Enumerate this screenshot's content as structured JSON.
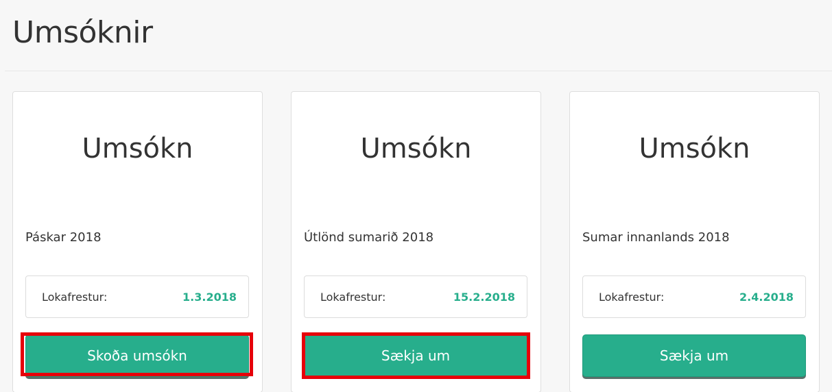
{
  "page": {
    "title": "Umsóknir"
  },
  "cards": [
    {
      "title": "Umsókn",
      "name": "Páskar 2018",
      "deadline_label": "Lokafrestur:",
      "deadline_value": "1.3.2018",
      "button_label": "Skoða umsókn",
      "highlighted": true
    },
    {
      "title": "Umsókn",
      "name": "Útlönd sumarið 2018",
      "deadline_label": "Lokafrestur:",
      "deadline_value": "15.2.2018",
      "button_label": "Sækja um",
      "highlighted": true
    },
    {
      "title": "Umsókn",
      "name": "Sumar innanlands 2018",
      "deadline_label": "Lokafrestur:",
      "deadline_value": "2.4.2018",
      "button_label": "Sækja um",
      "highlighted": false
    }
  ],
  "colors": {
    "accent": "#27ae8c",
    "highlight": "#e6000a",
    "background": "#f7f7f7",
    "card": "#ffffff"
  }
}
